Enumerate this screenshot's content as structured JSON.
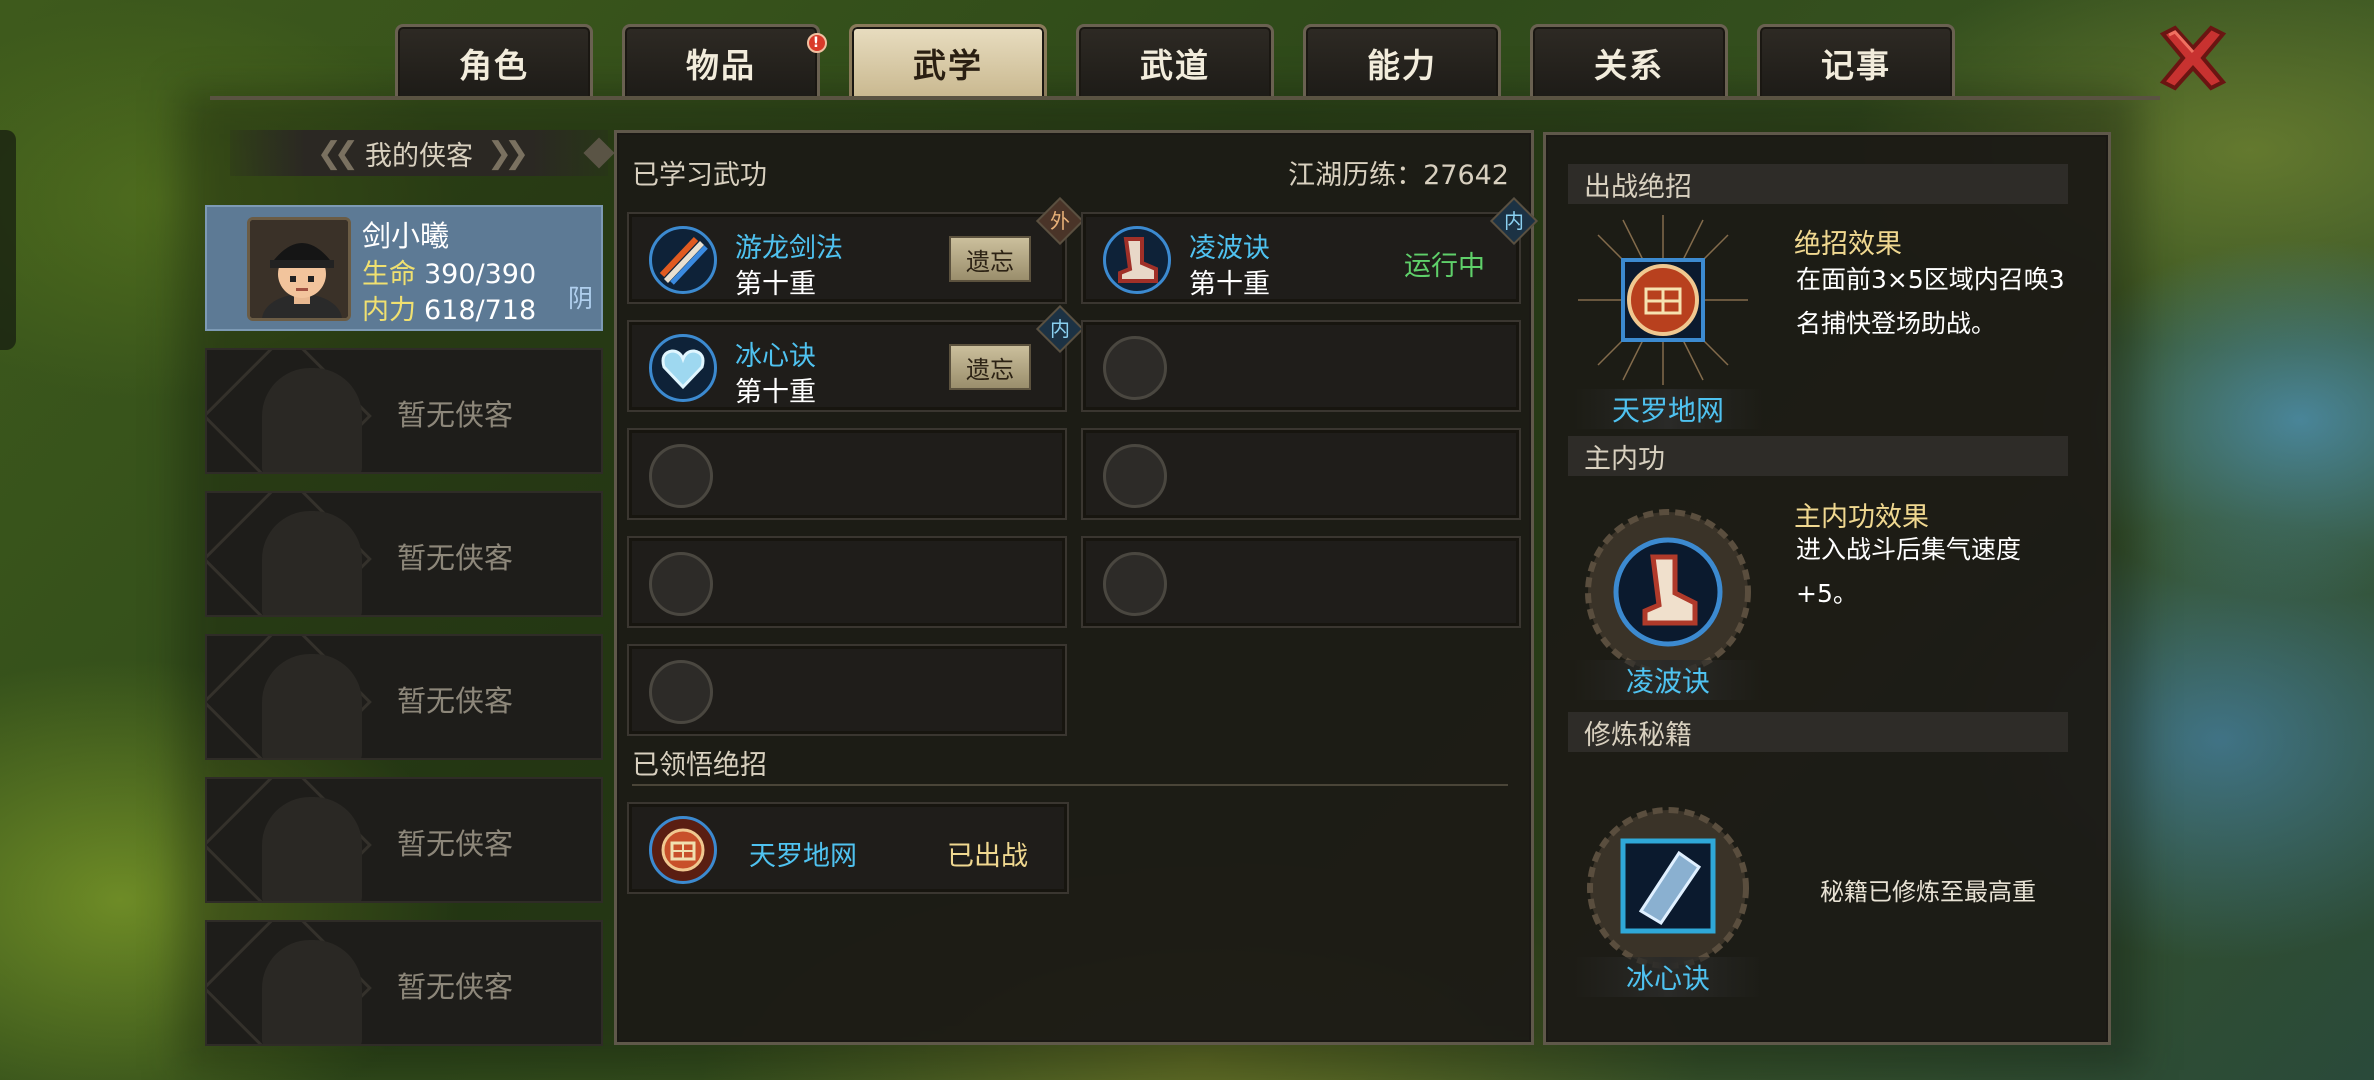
{
  "tabs": [
    {
      "label": "角色"
    },
    {
      "label": "物品",
      "badge": "!"
    },
    {
      "label": "武学"
    },
    {
      "label": "武道"
    },
    {
      "label": "能力"
    },
    {
      "label": "关系"
    },
    {
      "label": "记事"
    }
  ],
  "active_tab": "武学",
  "left": {
    "header": "我的侠客",
    "hero": {
      "name": "剑小曦",
      "hp_label": "生命",
      "hp": "390/390",
      "mp_label": "内力",
      "mp": "618/718",
      "attr": "阴"
    },
    "empty_label": "暂无侠客"
  },
  "middle": {
    "learned_title": "已学习武功",
    "exp_label": "江湖历练：",
    "exp_value": "27642",
    "skills": [
      {
        "name": "游龙剑法",
        "level": "第十重",
        "button": "遗忘",
        "tag": "外",
        "icon": "sword-icon"
      },
      {
        "name": "凌波诀",
        "level": "第十重",
        "status": "运行中",
        "tag": "内",
        "icon": "boot-icon"
      },
      {
        "name": "冰心诀",
        "level": "第十重",
        "button": "遗忘",
        "tag": "内",
        "icon": "ice-heart-icon"
      }
    ],
    "ultimate_title": "已领悟绝招",
    "ultimate": {
      "name": "天罗地网",
      "status": "已出战",
      "icon": "net-emblem-icon"
    }
  },
  "right": {
    "s1": {
      "title": "出战绝招",
      "name": "天罗地网",
      "effect_title": "绝招效果",
      "effect": "在面前3×5区域内召唤3名捕快登场助战。"
    },
    "s2": {
      "title": "主内功",
      "name": "凌波诀",
      "effect_title": "主内功效果",
      "effect": "进入战斗后集气速度+5。"
    },
    "s3": {
      "title": "修炼秘籍",
      "name": "冰心诀",
      "note": "秘籍已修炼至最高重"
    }
  },
  "colors": {
    "skill_name": "#4fc2f0",
    "running": "#5fd06a",
    "effect_title": "#f0d890",
    "selected_slot": "#5d7a95"
  }
}
